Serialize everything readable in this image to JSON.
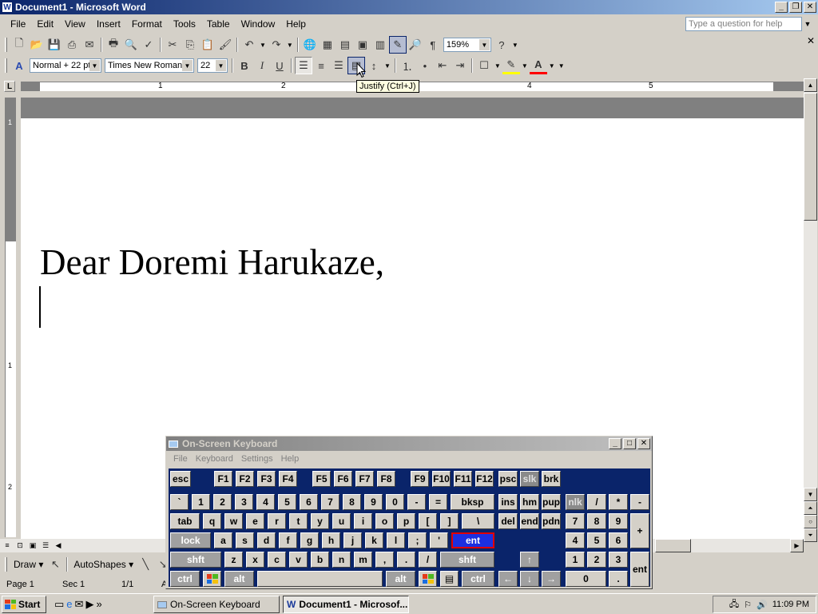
{
  "window": {
    "title": "Document1 - Microsoft Word",
    "app_icon": "W"
  },
  "menu": [
    "File",
    "Edit",
    "View",
    "Insert",
    "Format",
    "Tools",
    "Table",
    "Window",
    "Help"
  ],
  "help_box": {
    "placeholder": "Type a question for help"
  },
  "toolbar": {
    "zoom": "159%"
  },
  "format_toolbar": {
    "style": "Normal + 22 pt",
    "font": "Times New Roman",
    "size": "22",
    "bold": "B",
    "italic": "I",
    "underline": "U"
  },
  "tooltip": "Justify (Ctrl+J)",
  "ruler": {
    "corner": "L",
    "h_numbers": [
      "1",
      "1",
      "2",
      "3",
      "4",
      "5"
    ],
    "v_numbers": [
      "1",
      "1",
      "2"
    ]
  },
  "document": {
    "text": "Dear Doremi Harukaze,"
  },
  "drawing_toolbar": {
    "draw": "Draw",
    "autoshapes": "AutoShapes"
  },
  "status": {
    "page": "Page 1",
    "sec": "Sec 1",
    "pages": "1/1",
    "at": "A"
  },
  "osk": {
    "title": "On-Screen Keyboard",
    "menu": [
      "File",
      "Keyboard",
      "Settings",
      "Help"
    ],
    "row1": [
      "esc",
      "F1",
      "F2",
      "F3",
      "F4",
      "F5",
      "F6",
      "F7",
      "F8",
      "F9",
      "F10",
      "F11",
      "F12",
      "psc",
      "slk",
      "brk"
    ],
    "row2": [
      "`",
      "1",
      "2",
      "3",
      "4",
      "5",
      "6",
      "7",
      "8",
      "9",
      "0",
      "-",
      "=",
      "bksp",
      "ins",
      "hm",
      "pup",
      "nlk",
      "/",
      "*",
      "-"
    ],
    "row3": [
      "tab",
      "q",
      "w",
      "e",
      "r",
      "t",
      "y",
      "u",
      "i",
      "o",
      "p",
      "[",
      "]",
      "\\",
      "del",
      "end",
      "pdn",
      "7",
      "8",
      "9",
      "+"
    ],
    "row4": [
      "lock",
      "a",
      "s",
      "d",
      "f",
      "g",
      "h",
      "j",
      "k",
      "l",
      ";",
      "'",
      "ent",
      "4",
      "5",
      "6"
    ],
    "row5": [
      "shft",
      "z",
      "x",
      "c",
      "v",
      "b",
      "n",
      "m",
      ",",
      ".",
      "/",
      "shft",
      "↑",
      "1",
      "2",
      "3",
      "ent"
    ],
    "row6": [
      "ctrl",
      "alt",
      "alt",
      "ctrl",
      "←",
      "↓",
      "→",
      "0",
      "."
    ]
  },
  "taskbar": {
    "start": "Start",
    "tasks": [
      "On-Screen Keyboard",
      "Document1 - Microsof..."
    ],
    "time": "11:09 PM"
  }
}
